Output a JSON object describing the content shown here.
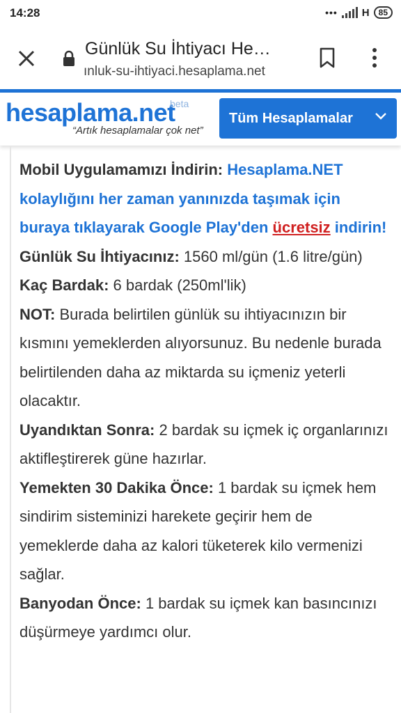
{
  "status_bar": {
    "time": "14:28",
    "dots": "•••",
    "network": "H",
    "battery": "85"
  },
  "browser": {
    "page_title": "Günlük Su İhtiyacı He…",
    "url": "ınluk-su-ihtiyaci.hesaplama.net"
  },
  "site": {
    "logo": "hesaplama.net",
    "beta": "beta",
    "tagline": "“Artık hesaplamalar çok net”",
    "all_calc_button": "Tüm Hesaplamalar"
  },
  "content": {
    "app_promo": {
      "label": "Mobil Uygulamamızı İndirin:",
      "text": "Hesaplama.NET kolaylığını her zaman yanınızda taşımak için buraya tıklayarak Google Play'den",
      "link": "ücretsiz",
      "tail": "indirin!"
    },
    "water_need": {
      "label": "Günlük Su İhtiyacınız:",
      "value": "1560 ml/gün (1.6 litre/gün)"
    },
    "cups": {
      "label": "Kaç Bardak:",
      "value": "6 bardak (250ml'lik)"
    },
    "note": {
      "label": "NOT:",
      "value": "Burada belirtilen günlük su ihtiyacınızın bir kısmını yemeklerden alıyorsunuz. Bu nedenle burada belirtilenden daha az miktarda su içmeniz yeterli olacaktır."
    },
    "after_waking": {
      "label": "Uyandıktan Sonra:",
      "value": "2 bardak su içmek iç organlarınızı aktifleştirerek güne hazırlar."
    },
    "before_meal": {
      "label": "Yemekten 30 Dakika Önce:",
      "value": "1 bardak su içmek hem sindirim sisteminizi harekete geçirir hem de yemeklerde daha az kalori tüketerek kilo vermenizi sağlar."
    },
    "before_bath": {
      "label": "Banyodan Önce:",
      "value": "1 bardak su içmek kan basıncınızı düşürmeye yardımcı olur."
    }
  }
}
